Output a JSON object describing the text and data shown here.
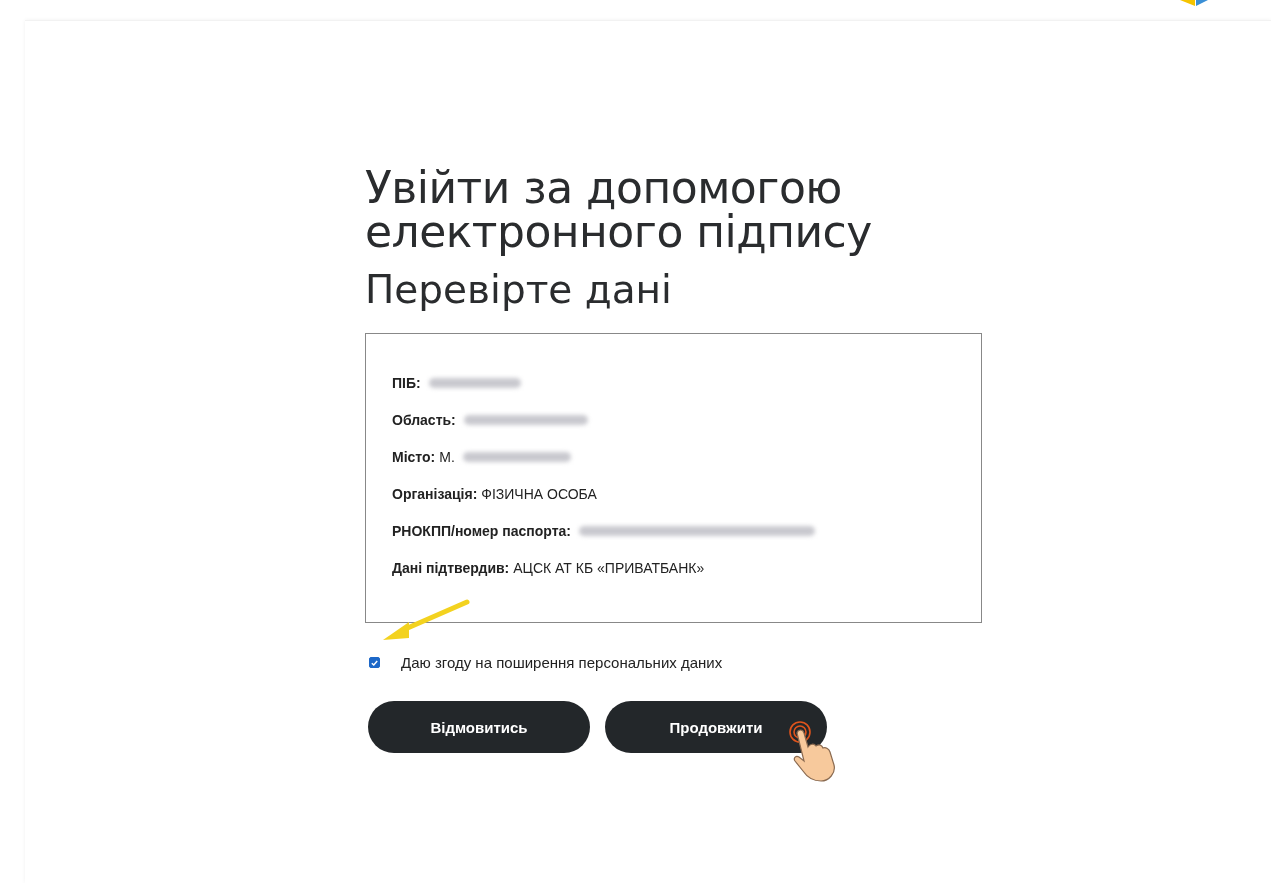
{
  "heading": {
    "title": "Увійти за допомогою електронного підпису",
    "subtitle": "Перевірте дані"
  },
  "details": [
    {
      "label": "ПІБ:",
      "redacted": true
    },
    {
      "label": "Область:",
      "redacted": true
    },
    {
      "label": "Місто:",
      "value": "М.",
      "redacted": true
    },
    {
      "label": "Організація:",
      "value": "ФІЗИЧНА ОСОБА"
    },
    {
      "label": "РНОКПП/номер паспорта:",
      "redacted": true
    },
    {
      "label": "Дані підтвердив:",
      "value": "АЦСК АТ КБ «ПРИВАТБАНК»"
    }
  ],
  "consent": {
    "label": "Даю згоду на поширення персональних даних",
    "checked": true
  },
  "buttons": [
    {
      "label": "Відмовитись",
      "tapped": false
    },
    {
      "label": "Продовжити",
      "tapped": true
    }
  ]
}
